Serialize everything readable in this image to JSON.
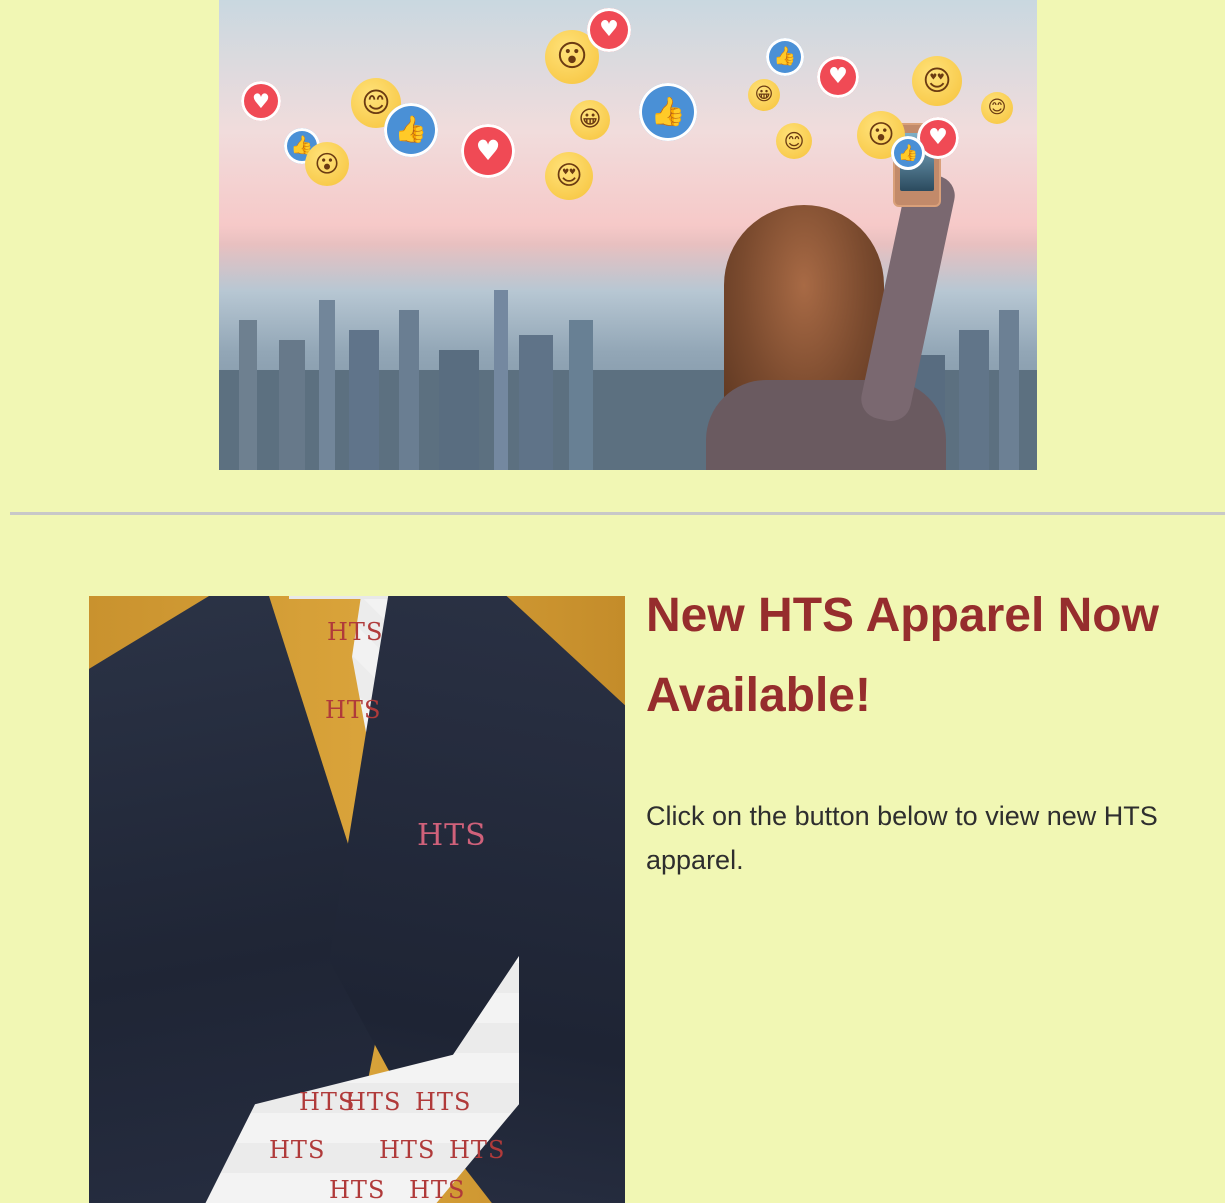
{
  "hero": {
    "alt_description": "hero-social-photo"
  },
  "apparel": {
    "headline": "New HTS Apparel Now Available!",
    "body": "Click on the button below to view new HTS apparel.",
    "brand_mark": "HTS"
  },
  "colors": {
    "background": "#f1f7b4",
    "headline": "#962d2d",
    "body_text": "#2e2e2e",
    "divider": "#c8c8c8"
  },
  "icons": {
    "heart": "heart-icon",
    "like": "thumbs-up-icon",
    "face": "smiley-icon"
  }
}
